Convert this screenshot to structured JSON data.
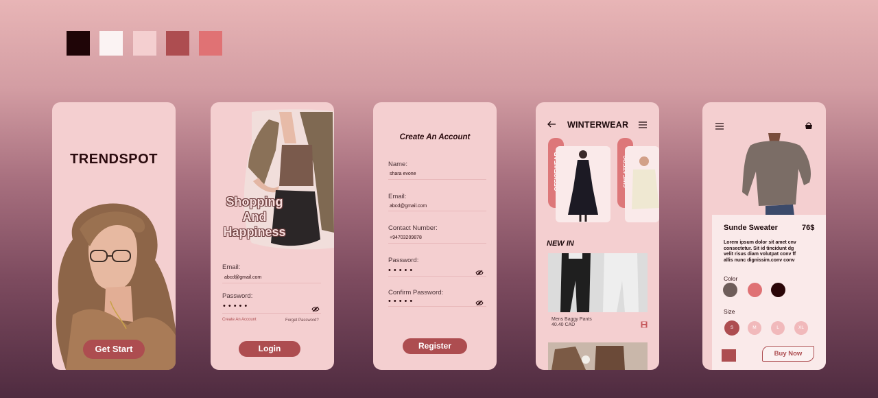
{
  "palette": [
    "#1f0507",
    "#fbf3f3",
    "#f4cfd0",
    "#ad4d50",
    "#e07274"
  ],
  "welcome": {
    "brand": "TRENDSPOT",
    "start_label": "Get Start"
  },
  "login": {
    "hero_line1": "Shopping",
    "hero_line2": "And",
    "hero_line3": "Happiness",
    "email_label": "Email:",
    "email_value": "abcd@gmail.com",
    "password_label": "Password:",
    "password_mask": "•••••",
    "create_account_link": "Create An Account",
    "forgot_password_link": "Forget Password?",
    "login_label": "Login"
  },
  "register": {
    "title": "Create An Account",
    "name_label": "Name:",
    "name_value": "shara evone",
    "email_label": "Email:",
    "email_value": "abcd@gmail.com",
    "contact_label": "Contact Number:",
    "contact_value": "+94703209878",
    "password_label": "Password:",
    "password_mask": "•••••",
    "confirm_label": "Confirm Password:",
    "confirm_mask": "•••••",
    "register_label": "Register"
  },
  "catalog": {
    "title": "WINTERWEAR",
    "categories": [
      "OFFICEWEAR",
      "SWEATERS"
    ],
    "section_title": "NEW IN",
    "product_name": "Mens Baggy Pants",
    "product_price": "40.40 CAD"
  },
  "detail": {
    "name": "Sunde Sweater",
    "price": "76$",
    "desc_line1": "Lorem ipsum dolor sit amet cnv",
    "desc_line2": "consectetur. Sit id tincidunt  dg",
    "desc_line3": "velit risus diam volutpat conv ff",
    "desc_line4": "allis nunc dignissim.conv conv",
    "color_label": "Color",
    "colors": [
      "#6e5d5a",
      "#df7174",
      "#2a0608"
    ],
    "size_label": "Size",
    "sizes": [
      "S",
      "M",
      "L",
      "XL"
    ],
    "selected_size": "S",
    "buy_label": "Buy Now"
  }
}
